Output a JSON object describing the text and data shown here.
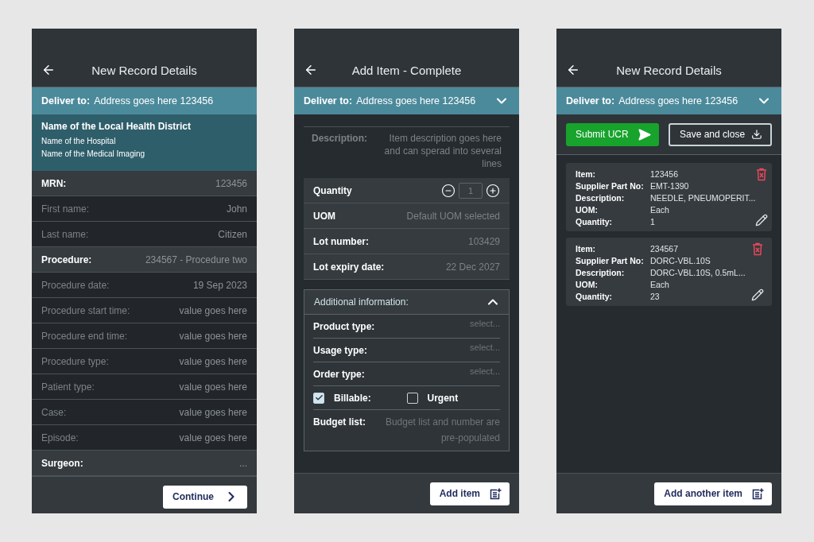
{
  "screens": [
    {
      "kind": "details",
      "title": "New Record Details",
      "deliver": {
        "label": "Deliver to:",
        "address": "Address goes here 123456"
      },
      "district": {
        "name": "Name of the Local Health District",
        "lines": [
          "Name of the Hospital",
          "Name of the Medical Imaging"
        ]
      },
      "fields": [
        {
          "label": "MRN:",
          "value": "123456",
          "editable": true
        },
        {
          "label": "First name:",
          "value": "John",
          "editable": false
        },
        {
          "label": "Last name:",
          "value": "Citizen",
          "editable": false
        },
        {
          "label": "Procedure:",
          "value": "234567 - Procedure two",
          "editable": true
        },
        {
          "label": "Procedure date:",
          "value": "19 Sep 2023",
          "editable": false
        },
        {
          "label": "Procedure start time:",
          "value": "value goes here",
          "editable": false
        },
        {
          "label": "Procedure end time:",
          "value": "value goes here",
          "editable": false
        },
        {
          "label": "Procedure type:",
          "value": "value goes here",
          "editable": false
        },
        {
          "label": "Patient type:",
          "value": "value goes here",
          "editable": false
        },
        {
          "label": "Case:",
          "value": "value goes here",
          "editable": false
        },
        {
          "label": "Episode:",
          "value": "value goes here",
          "editable": false
        },
        {
          "label": "Surgeon:",
          "value": "...",
          "editable": true
        }
      ],
      "action": {
        "label": "Continue"
      }
    },
    {
      "kind": "item",
      "title": "Add Item - Complete",
      "deliver": {
        "label": "Deliver to:",
        "address": "Address goes here 123456"
      },
      "description": {
        "label": "Description:",
        "value": "Item description goes here and can sperad into several lines"
      },
      "quantity": {
        "label": "Quantity",
        "value": "1"
      },
      "fields": [
        {
          "label": "UOM",
          "value": "Default UOM selected"
        },
        {
          "label": "Lot number:",
          "value": "103429"
        },
        {
          "label": "Lot expiry date:",
          "value": "22 Dec 2027"
        }
      ],
      "additional": {
        "title": "Additional information:",
        "expanded": true,
        "selects": [
          {
            "label": "Product type:",
            "placeholder": "select..."
          },
          {
            "label": "Usage type:",
            "placeholder": "select..."
          },
          {
            "label": "Order type:",
            "placeholder": "select..."
          }
        ],
        "checks": [
          {
            "label": "Billable:",
            "checked": true
          },
          {
            "label": "Urgent",
            "checked": false
          }
        ],
        "budget": {
          "label": "Budget list:",
          "value": "Budget list and number are pre-populated"
        }
      },
      "action": {
        "label": "Add item"
      }
    },
    {
      "kind": "list",
      "title": "New Record Details",
      "deliver": {
        "label": "Deliver to:",
        "address": "Address goes here 123456"
      },
      "buttons": [
        {
          "label": "Submit UCR",
          "kind": "primary"
        },
        {
          "label": "Save and close",
          "kind": "secondary"
        }
      ],
      "items": [
        {
          "fields": [
            {
              "label": "Item:",
              "value": "123456"
            },
            {
              "label": "Supplier Part No:",
              "value": "EMT-1390"
            },
            {
              "label": "Description:",
              "value": "NEEDLE, PNEUMOPERIT..."
            },
            {
              "label": "UOM:",
              "value": "Each"
            },
            {
              "label": "Quantity:",
              "value": "1"
            }
          ]
        },
        {
          "fields": [
            {
              "label": "Item:",
              "value": "234567"
            },
            {
              "label": "Supplier Part No:",
              "value": "DORC-VBL.10S"
            },
            {
              "label": "Description:",
              "value": "DORC-VBL.10S, 0.5mL..."
            },
            {
              "label": "UOM:",
              "value": "Each"
            },
            {
              "label": "Quantity:",
              "value": "23"
            }
          ]
        }
      ],
      "action": {
        "label": "Add another item"
      }
    }
  ]
}
